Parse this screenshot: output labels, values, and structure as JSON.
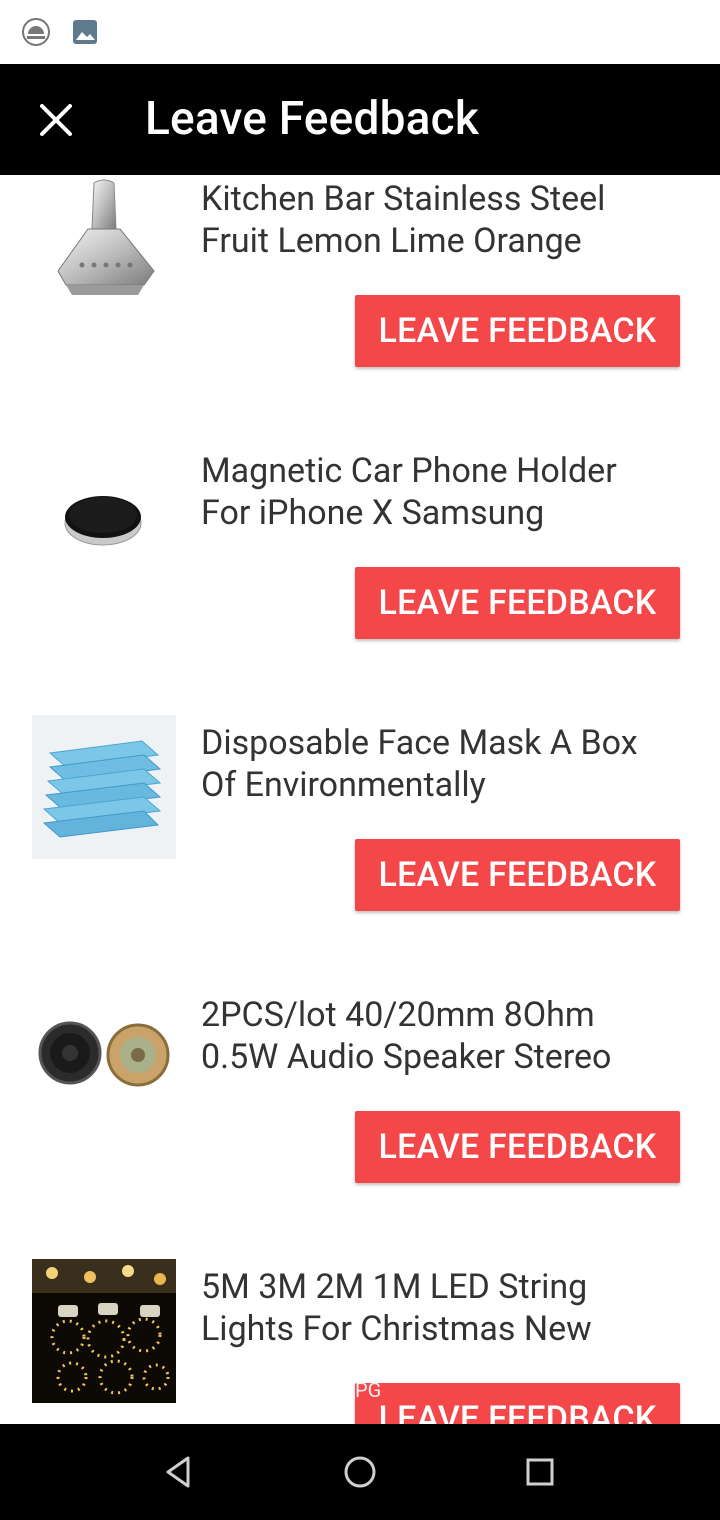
{
  "app_bar": {
    "title": "Leave Feedback"
  },
  "colors": {
    "accent": "#f44749",
    "app_bar_bg": "#000000"
  },
  "items": [
    {
      "title": "Kitchen Bar Stainless Steel Fruit Lemon Lime Orange",
      "button": "LEAVE FEEDBACK",
      "image": "lemon-squeezer-image"
    },
    {
      "title": "Magnetic Car Phone Holder For iPhone X Samsung",
      "button": "LEAVE FEEDBACK",
      "image": "magnetic-holder-image"
    },
    {
      "title": "Disposable Face Mask A Box Of Environmentally",
      "button": "LEAVE FEEDBACK",
      "image": "face-mask-image"
    },
    {
      "title": "2PCS/lot 40/20mm 8Ohm 0.5W Audio Speaker Stereo",
      "button": "LEAVE FEEDBACK",
      "image": "speaker-image"
    },
    {
      "title": "5M 3M 2M 1M LED String Lights For Christmas New",
      "button": "LEAVE FEEDBACK",
      "image": "led-lights-image"
    }
  ],
  "overlay_text": "PG",
  "nav": {
    "back": "back-icon",
    "home": "home-icon",
    "recents": "recents-icon"
  }
}
